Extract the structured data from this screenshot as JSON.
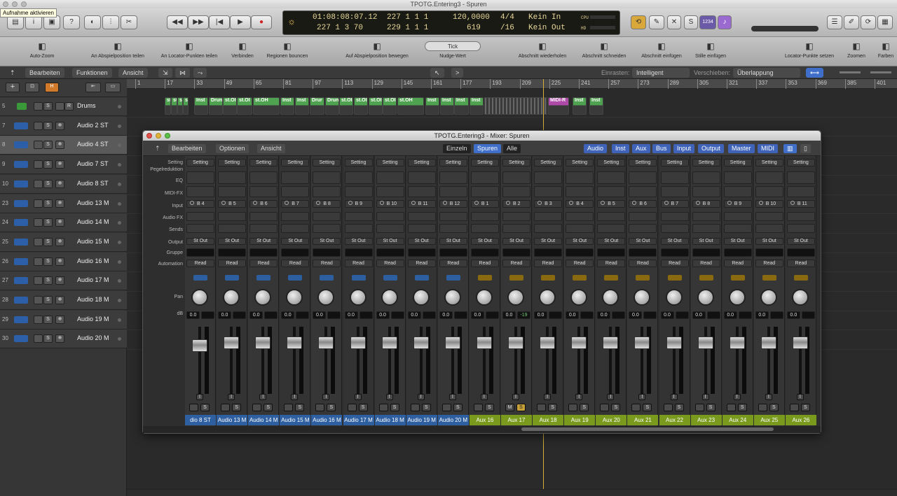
{
  "window": {
    "title": "TPOTG.Entering3 - Spuren",
    "tooltip": "Aufnahme aktivieren"
  },
  "lcd": {
    "smpte": "01:08:08:07.12",
    "bars_beats": "227  1  3    70",
    "pos_top": "227  1  1     1",
    "pos_bottom": "229  1  1     1",
    "tempo": "120,0000",
    "tempo_bottom": "619",
    "sig_top": "4/4",
    "sig_bottom": "/16",
    "in": "Kein In",
    "out": "Kein Out",
    "cpu_label": "CPU",
    "hd_label": "HD"
  },
  "controlbar": {
    "display_mode": "1234"
  },
  "toolbar": [
    {
      "label": "Auto-Zoom",
      "icon": "autozoom-icon"
    },
    {
      "label": "An Abspielposition teilen",
      "icon": "scissors-icon"
    },
    {
      "label": "An Locator-Punkten teilen",
      "icon": "scissors-locator-icon"
    },
    {
      "label": "Verbinden",
      "icon": "glue-icon"
    },
    {
      "label": "Regionen bouncen",
      "icon": "bounce-icon"
    },
    {
      "label": "Auf Abspielposition bewegen",
      "icon": "joystick-icon"
    },
    {
      "label": "Nudge-Wert",
      "icon": "nudge-icon",
      "value": "Tick"
    },
    {
      "label": "Abschnitt wiederholen",
      "icon": "repeat-section-icon"
    },
    {
      "label": "Abschnitt schneiden",
      "icon": "cut-section-icon"
    },
    {
      "label": "Abschnitt einfügen",
      "icon": "insert-section-icon"
    },
    {
      "label": "Stille einfügen",
      "icon": "insert-silence-icon"
    },
    {
      "label": "Locator-Punkte setzen",
      "icon": "locator-icon"
    },
    {
      "label": "Zoomen",
      "icon": "zoom-icon"
    },
    {
      "label": "Farben",
      "icon": "palette-icon"
    }
  ],
  "menubar": {
    "edit": "Bearbeiten",
    "functions": "Funktionen",
    "view": "Ansicht",
    "snap_label": "Einrasten:",
    "snap_value": "Intelligent",
    "drag_label": "Verschieben:",
    "drag_value": "Überlappung"
  },
  "tracks": [
    {
      "num": "5",
      "name": "Drums",
      "type": "midi"
    },
    {
      "num": "7",
      "name": "Audio 2 ST",
      "type": "audio"
    },
    {
      "num": "8",
      "name": "Audio 4 ST",
      "type": "audio",
      "selected": true
    },
    {
      "num": "9",
      "name": "Audio 7 ST",
      "type": "audio"
    },
    {
      "num": "10",
      "name": "Audio 8 ST",
      "type": "audio"
    },
    {
      "num": "23",
      "name": "Audio 13 M",
      "type": "audio"
    },
    {
      "num": "24",
      "name": "Audio 14 M",
      "type": "audio"
    },
    {
      "num": "25",
      "name": "Audio 15 M",
      "type": "audio"
    },
    {
      "num": "26",
      "name": "Audio 16 M",
      "type": "audio"
    },
    {
      "num": "27",
      "name": "Audio 17 M",
      "type": "audio"
    },
    {
      "num": "28",
      "name": "Audio 18 M",
      "type": "audio"
    },
    {
      "num": "29",
      "name": "Audio 19 M",
      "type": "audio"
    },
    {
      "num": "30",
      "name": "Audio 20 M",
      "type": "audio"
    }
  ],
  "ruler": [
    "1",
    "17",
    "33",
    "49",
    "65",
    "81",
    "97",
    "113",
    "129",
    "145",
    "161",
    "177",
    "193",
    "209",
    "225",
    "241",
    "257",
    "273",
    "289",
    "305",
    "321",
    "337",
    "353",
    "369",
    "385",
    "401",
    "417"
  ],
  "regions": [
    "st",
    "st",
    "st",
    "st",
    "Inst",
    "Drun",
    "st.OI",
    "st.OI",
    "st.OH",
    "Inst",
    "Inst",
    "Drur",
    "Drun",
    "st.OI",
    "st.OI",
    "st.OI",
    "st.OI",
    "st.OH",
    "Inst",
    "Inst",
    "Inst",
    "Inst",
    "MIDI-R",
    "Inst",
    "Inst"
  ],
  "mixer": {
    "title": "TPOTG.Entering3 - Mixer: Spuren",
    "menu": {
      "edit": "Bearbeiten",
      "options": "Optionen",
      "view": "Ansicht"
    },
    "view_modes": [
      "Einzeln",
      "Spuren",
      "Alle"
    ],
    "filters": [
      "Audio",
      "Inst",
      "Aux",
      "Bus",
      "Input",
      "Output",
      "Master",
      "MIDI"
    ],
    "row_labels": {
      "setting": "Setting",
      "gain": "Pegelreduktion",
      "eq": "EQ",
      "midifx": "MIDI-FX",
      "input": "Input",
      "audiofx": "Audio FX",
      "sends": "Sends",
      "output": "Output",
      "group": "Gruppe",
      "automation": "Automation",
      "pan": "Pan",
      "db": "dB"
    },
    "strips": [
      {
        "name": "dio 8 ST",
        "input": "B 4",
        "db2": "",
        "kind": "audio"
      },
      {
        "name": "Audio 13 M",
        "input": "B 5",
        "db2": "",
        "kind": "audio"
      },
      {
        "name": "Audio 14 M",
        "input": "B 6",
        "db2": "",
        "kind": "audio"
      },
      {
        "name": "Audio 15 M",
        "input": "B 7",
        "db2": "",
        "kind": "audio"
      },
      {
        "name": "Audio 16 M",
        "input": "B 8",
        "db2": "",
        "kind": "audio"
      },
      {
        "name": "Audio 17 M",
        "input": "B 9",
        "db2": "",
        "kind": "audio"
      },
      {
        "name": "Audio 18 M",
        "input": "B 10",
        "db2": "",
        "kind": "audio"
      },
      {
        "name": "Audio 19 M",
        "input": "B 11",
        "db2": "",
        "kind": "audio"
      },
      {
        "name": "Audio 20 M",
        "input": "B 12",
        "db2": "",
        "kind": "audio"
      },
      {
        "name": "Aux 16",
        "input": "B 1",
        "db2": "",
        "kind": "aux"
      },
      {
        "name": "Aux 17",
        "input": "B 2",
        "db2": "-19",
        "kind": "aux",
        "mute": "M",
        "solo_active": true
      },
      {
        "name": "Aux 18",
        "input": "B 3",
        "db2": "",
        "kind": "aux"
      },
      {
        "name": "Aux 19",
        "input": "B 4",
        "db2": "",
        "kind": "aux"
      },
      {
        "name": "Aux 20",
        "input": "B 5",
        "db2": "",
        "kind": "aux"
      },
      {
        "name": "Aux 21",
        "input": "B 6",
        "db2": "",
        "kind": "aux"
      },
      {
        "name": "Aux 22",
        "input": "B 7",
        "db2": "",
        "kind": "aux"
      },
      {
        "name": "Aux 23",
        "input": "B 8",
        "db2": "",
        "kind": "aux"
      },
      {
        "name": "Aux 24",
        "input": "B 9",
        "db2": "",
        "kind": "aux"
      },
      {
        "name": "Aux 25",
        "input": "B 10",
        "db2": "",
        "kind": "aux"
      },
      {
        "name": "Aux 26",
        "input": "B 11",
        "db2": "",
        "kind": "aux"
      }
    ],
    "strip_defaults": {
      "setting": "Setting",
      "output": "St Out",
      "automation": "Read",
      "db": "0.0",
      "solo": "S",
      "input_prefix": "I"
    }
  },
  "colors": {
    "audio_strip": "#2e5fa0",
    "aux_strip": "#7a9a1e",
    "lcd_text": "#e8d89a",
    "accent": "#d4b03a"
  }
}
